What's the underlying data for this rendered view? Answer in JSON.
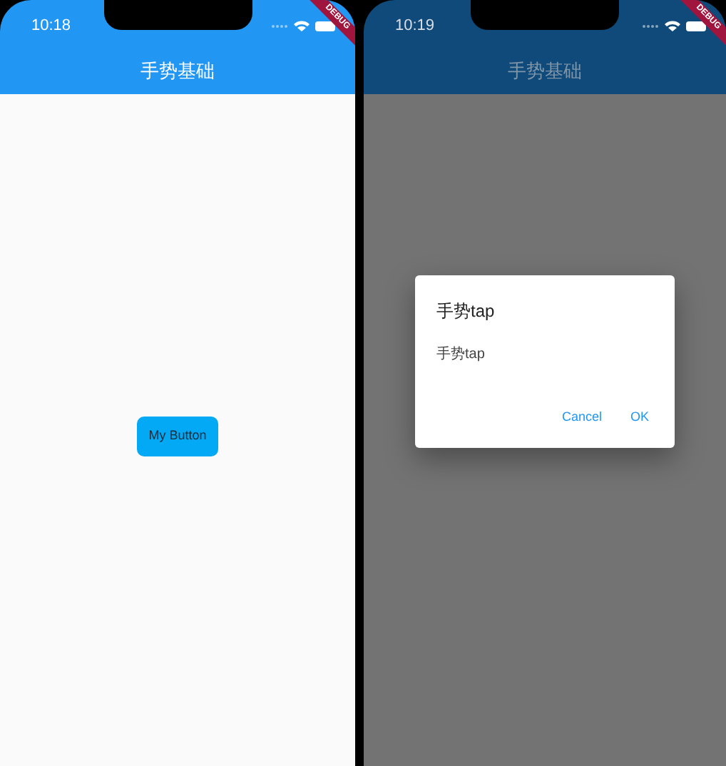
{
  "screens": [
    {
      "time": "10:18",
      "title": "手势基础",
      "debug_banner": "DEBUG",
      "dimmed": false,
      "button": {
        "label": "My Button"
      }
    },
    {
      "time": "10:19",
      "title": "手势基础",
      "debug_banner": "DEBUG",
      "dimmed": true,
      "dialog": {
        "title": "手势tap",
        "message": "手势tap",
        "actions": [
          "Cancel",
          "OK"
        ]
      }
    }
  ]
}
